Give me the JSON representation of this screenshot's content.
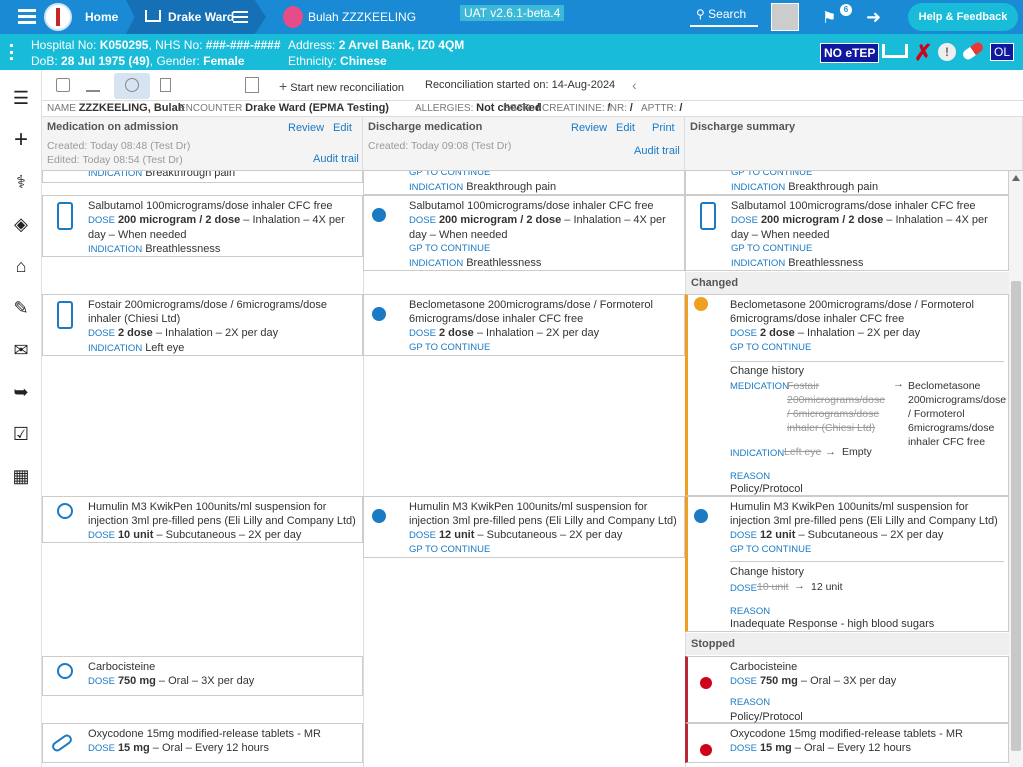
{
  "topbar": {
    "home": "Home",
    "ward": "Drake Ward",
    "patient": "Bulah ZZZKEELING",
    "version": "UAT v2.6.1-beta.4",
    "search": "Search",
    "flag_count": "6",
    "help": "Help & Feedback"
  },
  "patient": {
    "hospital_label": "Hospital No:",
    "hospital_no": "K050295",
    "nhs_label": "NHS No:",
    "nhs_no": "###-###-####",
    "address_label": "Address:",
    "address": "2 Arvel Bank, IZ0 4QM",
    "dob_label": "DoB:",
    "dob": "28 Jul 1975 (49)",
    "gender_label": "Gender:",
    "gender": "Female",
    "eth_label": "Ethnicity:",
    "ethnicity": "Chinese",
    "etep": "NO eTEP",
    "initials": "OL"
  },
  "toolbar": {
    "start": "Start new reconciliation",
    "started": "Reconciliation started on: 14-Aug-2024"
  },
  "infoline": {
    "name_lbl": "NAME",
    "name": "ZZZKEELING, Bulah",
    "enc_lbl": "ENCOUNTER",
    "enc": "Drake Ward (EPMA Testing)",
    "all_lbl": "ALLERGIES:",
    "all": "Not checked",
    "egfr_lbl": "EGFR:",
    "egfr": "/",
    "creat_lbl": "CREATININE:",
    "creat": "/",
    "inr_lbl": "INR:",
    "inr": "/",
    "aptt_lbl": "APTTR:",
    "aptt": "/"
  },
  "cols": {
    "admission": {
      "title": "Medication on admission",
      "review": "Review",
      "edit": "Edit",
      "created": "Created: Today 08:48 (Test Dr)",
      "edited": "Edited: Today 08:54 (Test Dr)",
      "audit": "Audit trail"
    },
    "discharge": {
      "title": "Discharge medication",
      "review": "Review",
      "edit": "Edit",
      "print": "Print",
      "created": "Created: Today 09:08 (Test Dr)",
      "audit": "Audit trail"
    },
    "summary": {
      "title": "Discharge summary"
    }
  },
  "labels": {
    "dose": "DOSE",
    "indication": "INDICATION",
    "gp": "GP TO CONTINUE",
    "reason": "REASON",
    "medication": "MEDICATION",
    "change_history": "Change history",
    "changed": "Changed",
    "stopped": "Stopped"
  },
  "meds": {
    "partial_ind": "Breakthrough pain",
    "salb_name": "Salbutamol 100micrograms/dose inhaler CFC free",
    "salb_dose": "200 microgram / 2 dose",
    "salb_route": "– Inhalation – 4X per day – When needed",
    "salb_ind": "Breathlessness",
    "fost_name": "Fostair 200micrograms/dose / 6micrograms/dose inhaler (Chiesi Ltd)",
    "fost_dose": "2 dose",
    "fost_route": "– Inhalation – 2X per day",
    "fost_ind": "Left eye",
    "beclo_name": "Beclometasone 200micrograms/dose / Formoterol 6micrograms/dose inhaler CFC free",
    "beclo_dose": "2 dose",
    "beclo_route": "– Inhalation – 2X per day",
    "hist_old_med": "Fostair 200micrograms/dose / 6micrograms/dose inhaler (Chiesi Ltd)",
    "hist_new_med": "Beclometasone 200micrograms/dose / Formoterol 6micrograms/dose inhaler CFC free",
    "hist_old_ind": "Left eye",
    "hist_new_ind": "Empty",
    "reason_policy": "Policy/Protocol",
    "hum_name": "Humulin M3 KwikPen 100units/ml suspension for injection 3ml pre-filled pens (Eli Lilly and Company Ltd)",
    "hum_dose_old": "10 unit",
    "hum_dose_new": "12 unit",
    "hum_route": "– Subcutaneous – 2X per day",
    "hum_hist_new": "12 unit",
    "hum_reason": "Inadequate Response - high blood sugars",
    "carbo_name": "Carbocisteine",
    "carbo_dose": "750 mg",
    "carbo_route": "– Oral – 3X per day",
    "oxy_name": "Oxycodone 15mg modified-release tablets - MR",
    "oxy_dose": "15 mg",
    "oxy_route": "– Oral – Every 12 hours"
  }
}
